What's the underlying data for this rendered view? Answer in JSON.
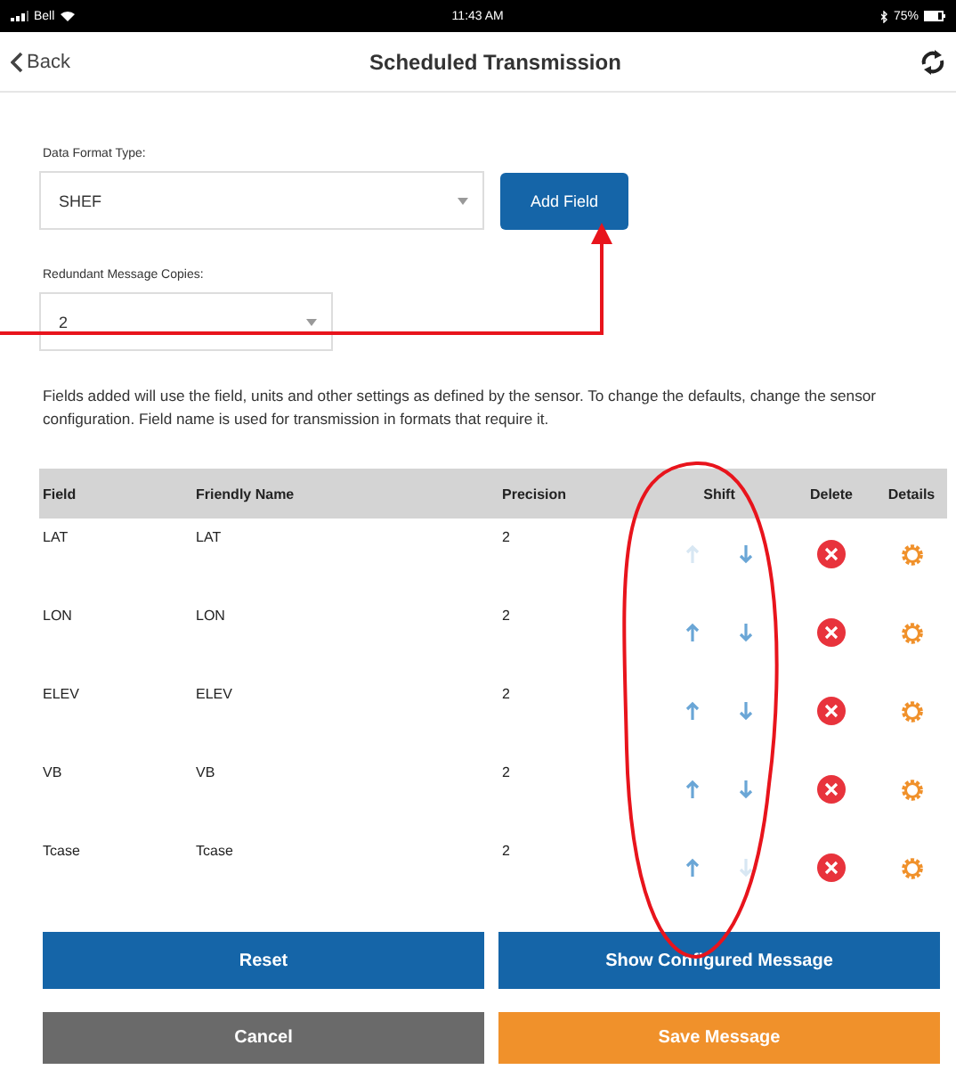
{
  "status_bar": {
    "carrier": "Bell",
    "time": "11:43 AM",
    "battery": "75%"
  },
  "nav": {
    "back": "Back",
    "title": "Scheduled Transmission"
  },
  "data_format": {
    "label": "Data Format Type:",
    "value": "SHEF"
  },
  "add_field_button": "Add Field",
  "copies": {
    "label": "Redundant Message Copies:",
    "value": "2"
  },
  "note": "Fields added will use the field, units and other settings as defined by the sensor. To change the defaults, change the sensor configuration. Field name is used for transmission in formats that require it.",
  "table": {
    "columns": [
      "Field",
      "Friendly Name",
      "Precision",
      "Shift",
      "Delete",
      "Details"
    ],
    "rows": [
      {
        "field": "LAT",
        "friendly_name": "LAT",
        "precision": "2",
        "up_disabled": true,
        "down_disabled": false
      },
      {
        "field": "LON",
        "friendly_name": "LON",
        "precision": "2",
        "up_disabled": false,
        "down_disabled": false
      },
      {
        "field": "ELEV",
        "friendly_name": "ELEV",
        "precision": "2",
        "up_disabled": false,
        "down_disabled": false
      },
      {
        "field": "VB",
        "friendly_name": "VB",
        "precision": "2",
        "up_disabled": false,
        "down_disabled": false
      },
      {
        "field": "Tcase",
        "friendly_name": "Tcase",
        "precision": "2",
        "up_disabled": false,
        "down_disabled": true
      }
    ]
  },
  "buttons": [
    {
      "label": "Reset",
      "kind": "primary"
    },
    {
      "label": "Show Configured Message",
      "kind": "primary"
    },
    {
      "label": "Cancel",
      "kind": "secondary"
    },
    {
      "label": "Save Message",
      "kind": "save"
    }
  ]
}
